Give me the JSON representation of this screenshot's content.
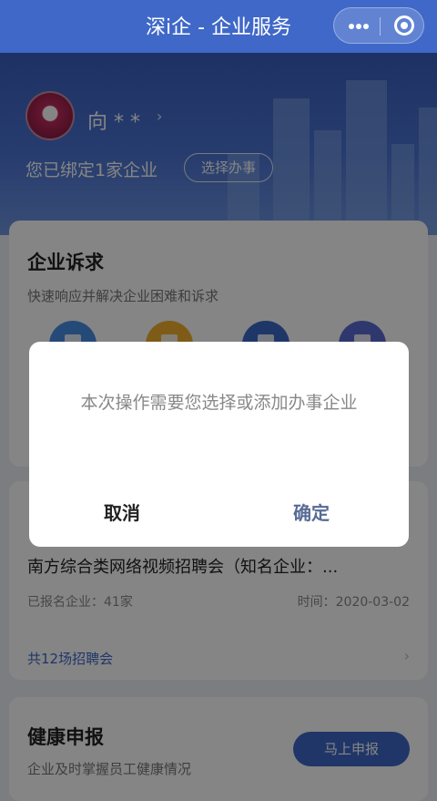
{
  "app": {
    "title": "深i企 - 企业服务",
    "menu_icon": "more-dots-icon",
    "close_icon": "target-close-icon"
  },
  "profile": {
    "name": "向 * *",
    "bound_text": "您已绑定1家企业",
    "choose_label": "选择办事"
  },
  "appeal": {
    "title": "企业诉求",
    "subtitle": "快速响应并解决企业困难和诉求",
    "icon_colors": [
      "#4a8fe6",
      "#f2b12e",
      "#3d69c9",
      "#5b6bd3"
    ]
  },
  "recruit": {
    "job_title": "南方综合类网络视频招聘会（知名企业：...",
    "signed_label": "已报名企业：41家",
    "time_label": "时间：2020-03-02",
    "more_link": "共12场招聘会"
  },
  "health": {
    "title": "健康申报",
    "subtitle": "企业及时掌握员工健康情况",
    "button": "马上申报"
  },
  "dialog": {
    "message": "本次操作需要您选择或添加办事企业",
    "cancel": "取消",
    "confirm": "确定"
  },
  "colors": {
    "brand": "#3f68c8",
    "confirm": "#576b95"
  }
}
